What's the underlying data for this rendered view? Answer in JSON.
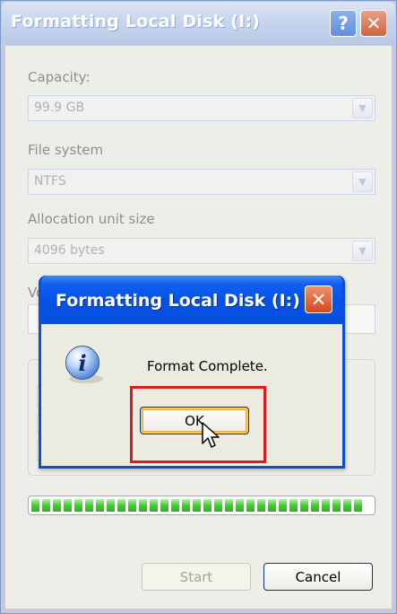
{
  "main_window": {
    "title": "Formatting Local Disk (I:)",
    "help_glyph": "?",
    "close_glyph": "✕",
    "capacity": {
      "label": "Capacity:",
      "value": "99.9 GB"
    },
    "file_system": {
      "label": "File system",
      "value": "NTFS"
    },
    "allocation": {
      "label": "Allocation unit size",
      "value": "4096 bytes"
    },
    "volume_label_fragment": "Vo",
    "progress_fraction": 1.0,
    "start_label": "Start",
    "cancel_label": "Cancel"
  },
  "dialog": {
    "title": "Formatting Local Disk (I:)",
    "close_glyph": "✕",
    "icon": "info-icon",
    "icon_glyph": "i",
    "message": "Format Complete.",
    "ok_label": "OK"
  },
  "colors": {
    "dialog_titlebar": "#0651e6",
    "highlight": "#e01a1a",
    "progress": "#3fcf2f"
  }
}
